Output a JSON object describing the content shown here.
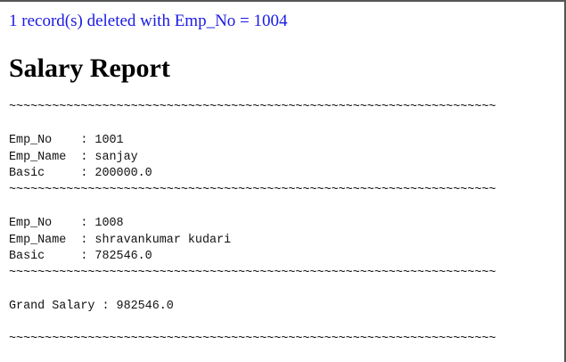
{
  "status_message": "1 record(s) deleted with Emp_No = 1004",
  "title": "Salary Report",
  "separator": "~~~~~~~~~~~~~~~~~~~~~~~~~~~~~~~~~~~~~~~~~~~~~~~~~~~~~~~~~~~~~~~~~~~~~~~~~~~~~~~~~~~~~~~~~~~~~~",
  "records": [
    {
      "emp_no_line": "Emp_No    : 1001",
      "emp_name_line": "Emp_Name  : sanjay",
      "basic_line": "Basic     : 200000.0"
    },
    {
      "emp_no_line": "Emp_No    : 1008",
      "emp_name_line": "Emp_Name  : shravankumar kudari",
      "basic_line": "Basic     : 782546.0"
    }
  ],
  "grand_salary_line": "Grand Salary : 982546.0"
}
